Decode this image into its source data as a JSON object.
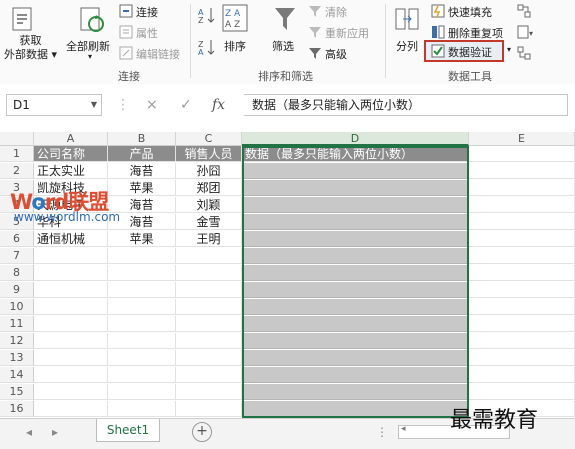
{
  "ribbon": {
    "get_external": "获取\n外部数据",
    "get_external_1": "获取",
    "get_external_2": "外部数据 ▾",
    "refresh_all": "全部刷新",
    "connections": "连接",
    "properties": "属性",
    "edit_links": "编辑链接",
    "group_connections": "连接",
    "sort": "排序",
    "filter": "筛选",
    "clear": "清除",
    "reapply": "重新应用",
    "advanced": "高级",
    "group_sort_filter": "排序和筛选",
    "text_to_columns": "分列",
    "flash_fill": "快速填充",
    "remove_duplicates": "删除重复项",
    "data_validation": "数据验证",
    "group_data_tools": "数据工具"
  },
  "formula_bar": {
    "name_box": "D1",
    "fx": "fx",
    "cancel": "×",
    "enter": "✓",
    "content": "数据（最多只能输入两位小数）"
  },
  "columns": [
    "A",
    "B",
    "C",
    "D",
    "E"
  ],
  "rows": [
    "1",
    "2",
    "3",
    "4",
    "5",
    "6",
    "7",
    "8",
    "9",
    "10",
    "11",
    "12",
    "13",
    "14",
    "15",
    "16"
  ],
  "header_row": [
    "公司名称",
    "产品",
    "销售人员",
    "数据（最多只能输入两位小数）"
  ],
  "data_rows": [
    [
      "正太实业",
      "海苔",
      "孙囧"
    ],
    [
      "凯旋科技",
      "苹果",
      "郑团"
    ],
    [
      "天源电子",
      "海苔",
      "刘颖"
    ],
    [
      "华科",
      "海苔",
      "金雪"
    ],
    [
      "通恒机械",
      "苹果",
      "王明"
    ]
  ],
  "tabs": {
    "sheet1": "Sheet1",
    "add": "+"
  },
  "watermark": {
    "brand_w": "W",
    "brand_o": "o",
    "brand_rest": "rd联盟",
    "url": "www.wordlm.com",
    "corner": "最需教育"
  },
  "colors": {
    "accent": "#217346",
    "header_fill": "#8c8c8c",
    "selection_fill": "#c8c8c8",
    "highlight_box": "#c0392b"
  }
}
